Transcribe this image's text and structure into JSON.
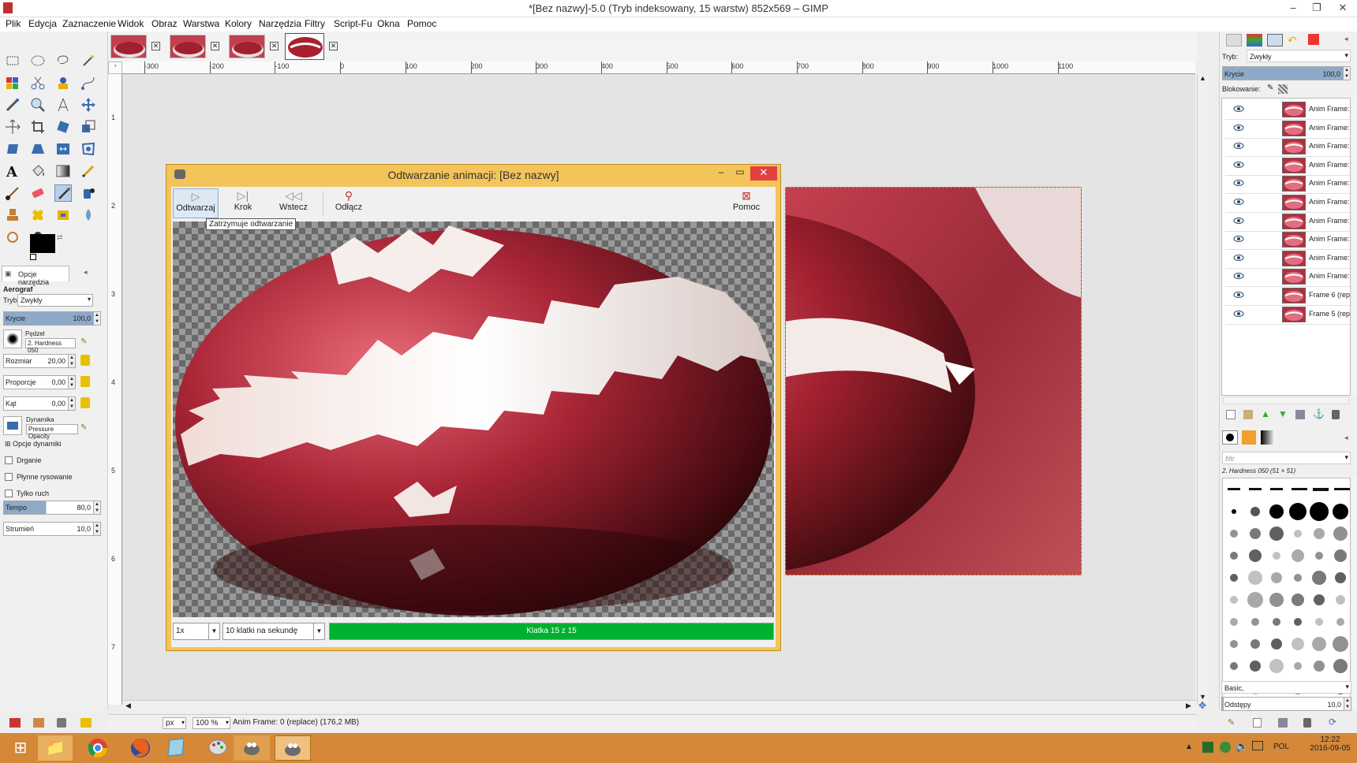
{
  "window": {
    "title": "*[Bez nazwy]-5.0 (Tryb indeksowany, 15 warstw) 852x569 – GIMP"
  },
  "menu": [
    "Plik",
    "Edycja",
    "Zaznaczenie",
    "Widok",
    "Obraz",
    "Warstwa",
    "Kolory",
    "Narzędzia",
    "Filtry",
    "Script-Fu",
    "Okna",
    "Pomoc"
  ],
  "toolbox": {
    "tab_label": "Opcje narzędzia",
    "tool_name": "Aerograf",
    "mode_label": "Tryb:",
    "mode_value": "Zwykły",
    "opacity_label": "Krycie",
    "opacity_value": "100,0",
    "brush_label": "Pędzel",
    "brush_value": "2. Hardness 050",
    "size_label": "Rozmiar",
    "size_value": "20,00",
    "ratio_label": "Proporcje",
    "ratio_value": "0,00",
    "angle_label": "Kąt",
    "angle_value": "0,00",
    "dynamics_label": "Dynamika",
    "dynamics_value": "Pressure Opacity",
    "dynamics_options": "Opcje dynamiki",
    "jitter": "Drganie",
    "smooth": "Płynne rysowanie",
    "motion_only": "Tylko ruch",
    "rate_label": "Tempo",
    "rate_value": "80,0",
    "flow_label": "Strumień",
    "flow_value": "10,0"
  },
  "ruler": {
    "h": [
      "-300",
      "-200",
      "-100",
      "0",
      "100",
      "200",
      "300",
      "400",
      "500",
      "600",
      "700",
      "800",
      "900",
      "1000",
      "1100"
    ],
    "v": [
      "1",
      "2",
      "3",
      "4",
      "5",
      "6",
      "7"
    ]
  },
  "dialog": {
    "title": "Odtwarzanie animacji: [Bez nazwy]",
    "play": "Odtwarzaj",
    "step": "Krok",
    "back": "Wstecz",
    "detach": "Odłącz",
    "help": "Pomoc",
    "tooltip": "Zatrzymuje odtwarzanie",
    "zoom": "1x",
    "fps": "10 klatki na sekundę",
    "progress_text": "Klatka 15 z 15",
    "progress": 1.0
  },
  "layers_panel": {
    "mode_label": "Tryb:",
    "mode_value": "Zwykły",
    "opacity_label": "Krycie",
    "opacity_value": "100,0",
    "lock_label": "Blokowanie:",
    "layers": [
      "Anim Frame:",
      "Anim Frame:",
      "Anim Frame:",
      "Anim Frame:",
      "Anim Frame:",
      "Anim Frame:",
      "Anim Frame:",
      "Anim Frame:",
      "Anim Frame:",
      "Anim Frame:",
      "Frame 6 (rep",
      "Frame 5 (rep"
    ]
  },
  "brushes_panel": {
    "filter_placeholder": "filtr",
    "brush_name": "2. Hardness 050 (51 × 51)",
    "preset": "Basic,",
    "spacing_label": "Odstępy",
    "spacing_value": "10,0"
  },
  "status": {
    "unit": "px",
    "zoom": "100 %",
    "text": "Anim Frame: 0 (replace) (176,2 MB)"
  },
  "taskbar": {
    "lang": "POL",
    "time": "12:22",
    "date": "2016-09-05"
  },
  "colors": {
    "accent": "#f3c45a",
    "progress": "#00b030",
    "taskbar": "#d48838"
  }
}
